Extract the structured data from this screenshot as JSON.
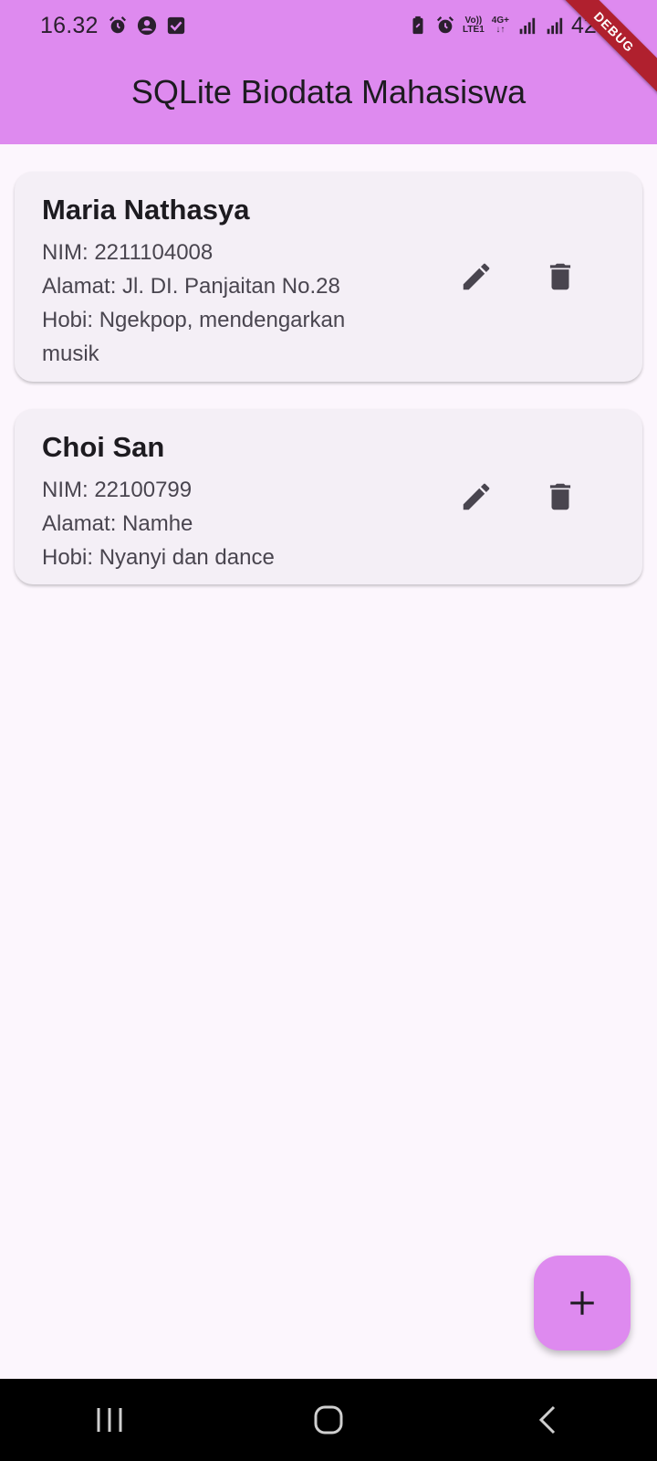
{
  "status_bar": {
    "time": "16.32",
    "battery": "42%",
    "network_top": "Vo))",
    "network_bottom": "LTE1",
    "signal_type": "4G+"
  },
  "app_bar": {
    "title": "SQLite Biodata Mahasiswa",
    "debug_label": "DEBUG",
    "color": "#de8aef"
  },
  "students": [
    {
      "name": "Maria Nathasya",
      "nim": "NIM: 2211104008",
      "alamat": "Alamat: Jl. DI. Panjaitan No.28",
      "hobi": "Hobi: Ngekpop, mendengarkan musik"
    },
    {
      "name": "Choi San",
      "nim": "NIM: 22100799",
      "alamat": "Alamat: Namhe",
      "hobi": "Hobi: Nyanyi dan dance"
    }
  ],
  "actions": {
    "edit_icon": "pencil-icon",
    "delete_icon": "trash-icon",
    "add_icon": "plus-icon"
  },
  "nav": {
    "recents_icon": "recents-icon",
    "home_icon": "home-icon",
    "back_icon": "back-icon"
  }
}
